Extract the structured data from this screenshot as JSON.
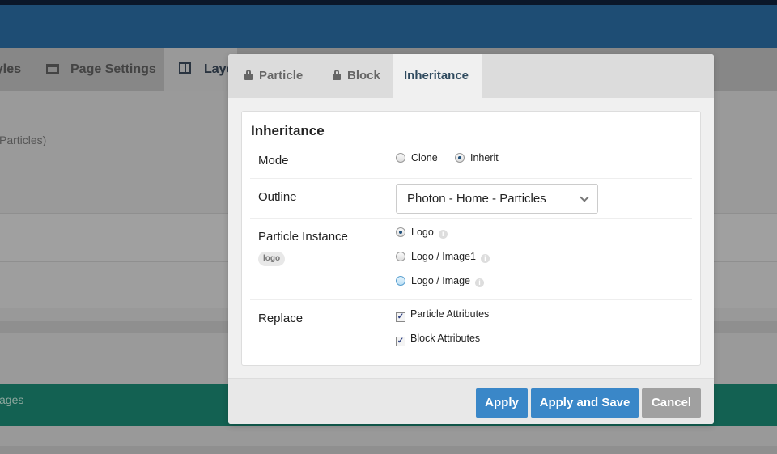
{
  "background": {
    "tabs": [
      {
        "label": "Styles",
        "visible_text": "yles"
      },
      {
        "label": "Page Settings",
        "icon": "page-settings-icon"
      },
      {
        "label": "Layout",
        "visible_text": "Layo",
        "icon": "layout-columns-icon"
      }
    ],
    "outline_fragment": "Particles)",
    "green_bar_fragment": "ages"
  },
  "modal": {
    "tabs": [
      {
        "label": "Particle",
        "icon": "lock-icon",
        "active": false
      },
      {
        "label": "Block",
        "icon": "lock-icon",
        "active": false
      },
      {
        "label": "Inheritance",
        "active": true
      }
    ],
    "panel_title": "Inheritance",
    "mode": {
      "label": "Mode",
      "options": [
        "Clone",
        "Inherit"
      ],
      "selected": "Inherit"
    },
    "outline": {
      "label": "Outline",
      "value": "Photon - Home - Particles"
    },
    "particle_instance": {
      "label": "Particle Instance",
      "badge": "logo",
      "options": [
        "Logo",
        "Logo / Image1",
        "Logo / Image"
      ],
      "selected": "Logo"
    },
    "replace": {
      "label": "Replace",
      "options": [
        {
          "label": "Particle Attributes",
          "checked": true
        },
        {
          "label": "Block Attributes",
          "checked": true
        }
      ]
    },
    "buttons": {
      "apply": "Apply",
      "apply_save": "Apply and Save",
      "cancel": "Cancel"
    }
  },
  "colors": {
    "header": "#1e4d74",
    "primary": "#3a87c8",
    "cancel": "#a0a0a0",
    "green": "#136152"
  }
}
